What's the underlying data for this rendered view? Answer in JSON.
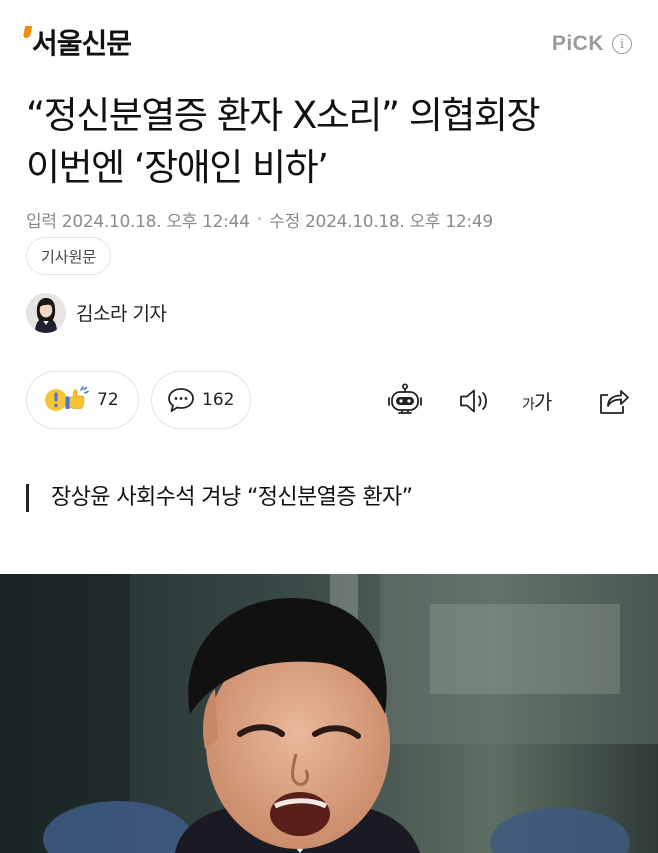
{
  "header": {
    "logo_text": "서울신문",
    "pick_label": "PiCK",
    "info_glyph": "i"
  },
  "article": {
    "title_line1": "“정신분열증 환자 X소리” 의협회장",
    "title_line2": "이번엔 ‘장애인 비하’",
    "published_label": "입력",
    "published": "2024.10.18. 오후 12:44",
    "updated_label": "수정",
    "updated": "2024.10.18. 오후 12:49",
    "original_link": "기사원문",
    "author": "김소라 기자",
    "subheading": "장상윤 사회수석 겨냥 “정신분열증 환자”"
  },
  "actions": {
    "reaction_count": "72",
    "comment_count": "162",
    "font_small": "가",
    "font_large": "가"
  },
  "icons": [
    "info-icon",
    "reaction-icon",
    "comment-icon",
    "robot-summary-icon",
    "speaker-icon",
    "font-size-icon",
    "share-icon"
  ],
  "colors": {
    "logo_accent": "#f28c00",
    "muted": "#8a8a8a",
    "border": "#e3e3e3"
  }
}
